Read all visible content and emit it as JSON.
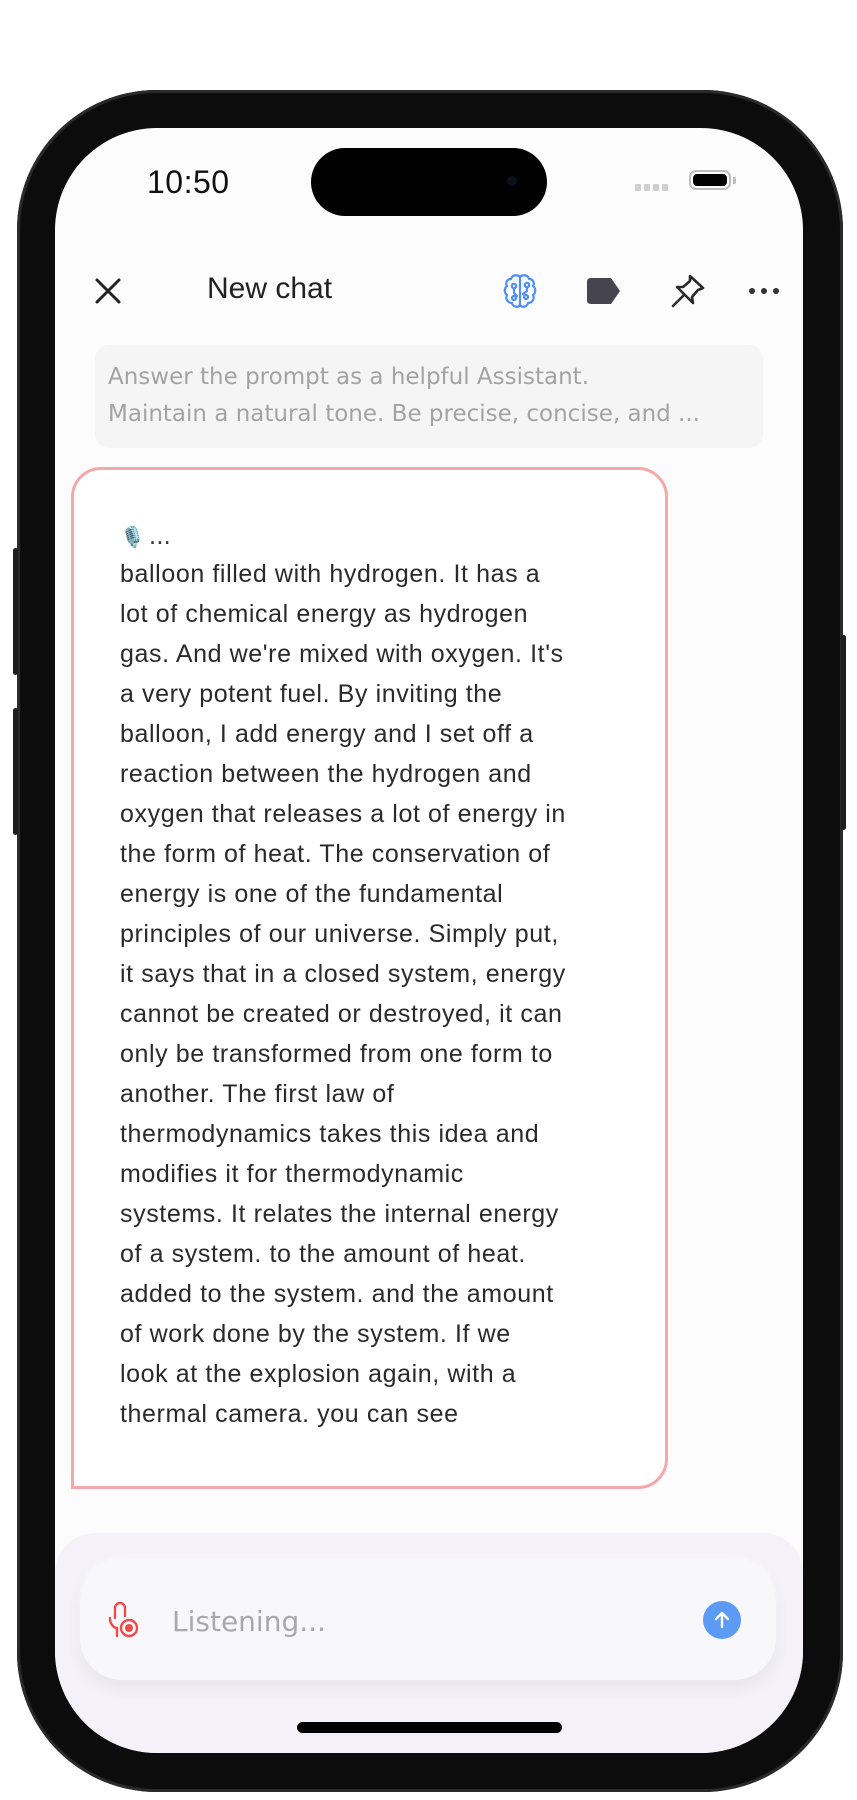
{
  "status_bar": {
    "time": "10:50"
  },
  "header": {
    "title": "New chat",
    "icons": [
      "close-icon",
      "brain-icon",
      "tag-icon",
      "pin-icon",
      "more-icon"
    ]
  },
  "colors": {
    "accent_blue": "#5b9bf5",
    "brain_icon": "#4f8ff5",
    "bubble_border": "#f5a7ab",
    "recording_red": "#ef4b4b",
    "tag_icon": "#46454f"
  },
  "system_prompt": {
    "lines": [
      "Answer the prompt as a helpful Assistant.",
      "Maintain a natural tone. Be precise, concise, and ..."
    ]
  },
  "message": {
    "header_icon": "🎙️",
    "header_text": "...",
    "lines": [
      "balloon filled with hydrogen. It has a",
      "lot of chemical energy as hydrogen",
      "gas. And we're mixed with oxygen. It's",
      "a very potent fuel. By inviting the",
      "balloon, I add energy and I set off a",
      "reaction between the hydrogen and",
      "oxygen that releases a lot of energy in",
      "the form of heat. The conservation of",
      "energy is one of the fundamental",
      "principles of our universe. Simply put,",
      "it says that in a closed system, energy",
      "cannot be created or destroyed, it can",
      "only be transformed from one form to",
      "another. The first law of",
      "thermodynamics takes this idea and",
      "modifies it for thermodynamic",
      "systems. It relates the internal energy",
      "of a system. to the amount of heat.",
      "added to the system. and the amount",
      "of work done by the system. If we",
      "look at the explosion again, with a",
      "thermal camera. you can see"
    ]
  },
  "composer": {
    "placeholder": "Listening...",
    "value": ""
  }
}
